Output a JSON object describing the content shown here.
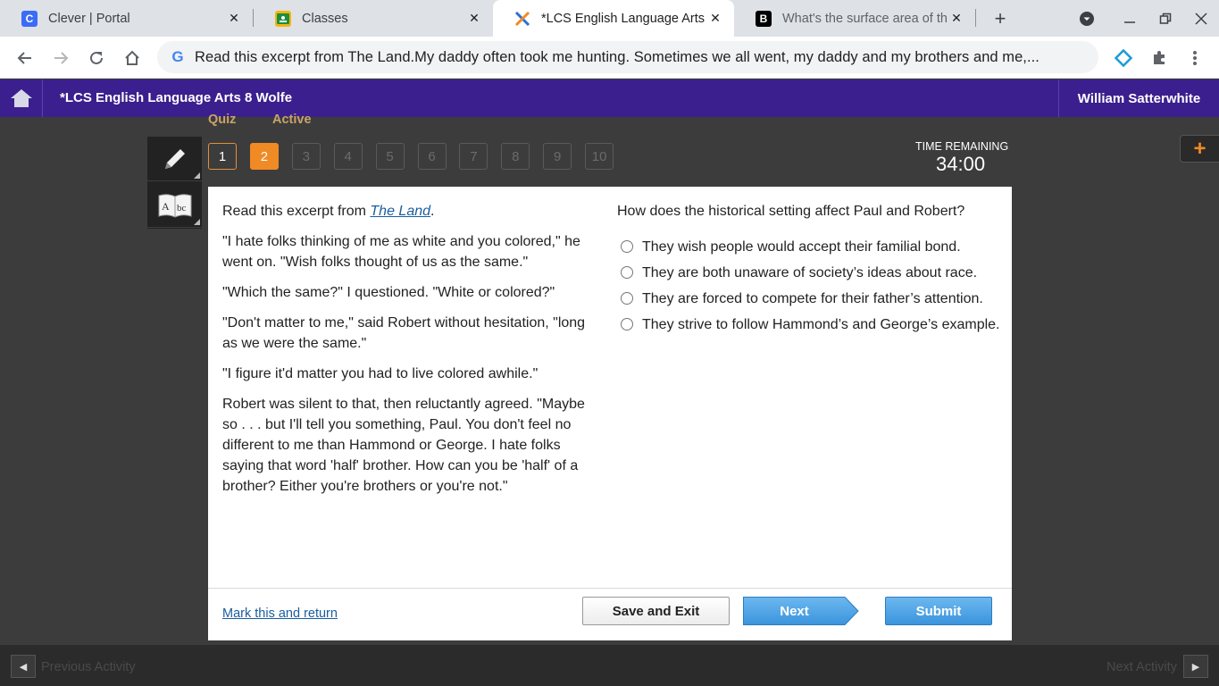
{
  "browser": {
    "tabs": [
      {
        "title": "Clever | Portal",
        "favicon": "clever-icon",
        "favicon_color": "#3b6cf6"
      },
      {
        "title": "Classes",
        "favicon": "google-classroom-icon",
        "favicon_color": "#f6b40e"
      },
      {
        "title": "*LCS English Language Arts",
        "favicon": "edgenuity-icon",
        "favicon_color": "#ffffff",
        "active": true
      },
      {
        "title": "What's the surface area of th",
        "favicon": "brainly-icon",
        "favicon_color": "#000000"
      }
    ],
    "url": "Read this excerpt from The Land.My daddy often took me hunting. Sometimes we all went, my daddy and my brothers and me,..."
  },
  "app": {
    "course_title": "*LCS English Language Arts 8 Wolfe",
    "user_name": "William Satterwhite",
    "accent_color": "#3b1f8e"
  },
  "quiz": {
    "label": "Quiz",
    "status": "Active",
    "numbers": [
      "1",
      "2",
      "3",
      "4",
      "5",
      "6",
      "7",
      "8",
      "9",
      "10"
    ],
    "current": 2,
    "time_label": "TIME REMAINING",
    "time_value": "34:00"
  },
  "passage": {
    "intro_prefix": "Read this excerpt from ",
    "book_title": "The Land",
    "intro_suffix": ".",
    "paragraphs": [
      "\"I hate folks thinking of me as white and you colored,\" he went on. \"Wish folks thought of us as the same.\"",
      "\"Which the same?\" I questioned. \"White or colored?\"",
      "\"Don't matter to me,\" said Robert without hesitation, \"long as we were the same.\"",
      "\"I figure it'd matter you had to live colored awhile.\"",
      "Robert was silent to that, then reluctantly agreed. \"Maybe so . . . but I'll tell you something, Paul. You don't feel no different to me than Hammond or George. I hate folks saying that word 'half' brother. How can you be 'half' of a brother? Either you're brothers or you're not.\""
    ]
  },
  "question": {
    "text": "How does the historical setting affect Paul and Robert?",
    "options": [
      "They wish people would accept their familial bond.",
      "They are both unaware of society’s ideas about race.",
      "They are forced to compete for their father’s attention.",
      "They strive to follow Hammond’s and George’s example."
    ]
  },
  "footer": {
    "mark_link": "Mark this and return",
    "save_label": "Save and Exit",
    "next_label": "Next",
    "submit_label": "Submit"
  },
  "activity_nav": {
    "previous": "Previous Activity",
    "next": "Next Activity"
  }
}
